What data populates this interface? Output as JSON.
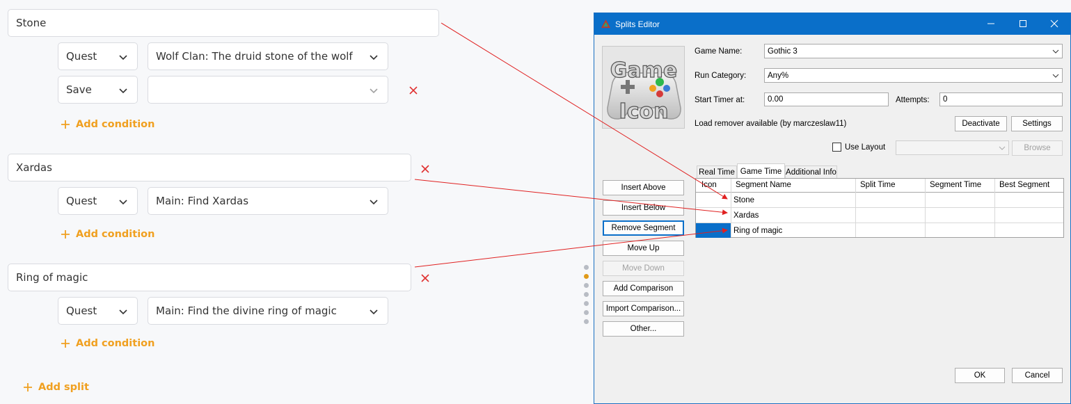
{
  "left": {
    "splits": [
      {
        "name": "Stone",
        "conditions": [
          {
            "type": "Quest",
            "value": "Wolf Clan: The druid stone of the wolf"
          },
          {
            "type": "Save",
            "value": ""
          }
        ]
      },
      {
        "name": "Xardas",
        "conditions": [
          {
            "type": "Quest",
            "value": "Main: Find Xardas"
          }
        ]
      },
      {
        "name": "Ring of magic",
        "conditions": [
          {
            "type": "Quest",
            "value": "Main: Find the divine ring of magic"
          }
        ]
      }
    ],
    "add_condition_label": "Add condition",
    "add_split_label": "Add split",
    "colors": {
      "accent": "#f0a020",
      "remove": "#e03030",
      "arrow": "#e02020"
    }
  },
  "window": {
    "title": "Splits Editor",
    "game_icon_text": [
      "Game",
      "Icon"
    ],
    "game_name_label": "Game Name:",
    "game_name": "Gothic 3",
    "run_category_label": "Run Category:",
    "run_category": "Any%",
    "start_timer_label": "Start Timer at:",
    "start_timer": "0.00",
    "attempts_label": "Attempts:",
    "attempts": "0",
    "load_remover_text": "Load remover available (by marczeslaw11)",
    "deactivate_label": "Deactivate",
    "settings_label": "Settings",
    "use_layout_label": "Use Layout",
    "browse_label": "Browse",
    "side_buttons": [
      "Insert Above",
      "Insert Below",
      "Remove Segment",
      "Move Up",
      "Move Down",
      "Add Comparison",
      "Import Comparison...",
      "Other..."
    ],
    "tabs": [
      "Real Time",
      "Game Time",
      "Additional Info"
    ],
    "active_tab": "Game Time",
    "columns": [
      "Icon",
      "Segment Name",
      "Split Time",
      "Segment Time",
      "Best Segment"
    ],
    "rows": [
      {
        "name": "Stone",
        "split_time": "",
        "segment_time": "",
        "best_segment": ""
      },
      {
        "name": "Xardas",
        "split_time": "",
        "segment_time": "",
        "best_segment": ""
      },
      {
        "name": "Ring of magic",
        "split_time": "",
        "segment_time": "",
        "best_segment": ""
      }
    ],
    "ok_label": "OK",
    "cancel_label": "Cancel",
    "colors": {
      "titlebar": "#0a6fc9",
      "selection": "#0a6fc9"
    }
  }
}
